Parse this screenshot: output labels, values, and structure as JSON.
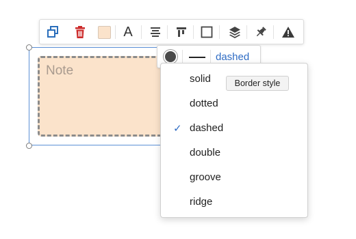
{
  "toolbar": {
    "icons": [
      "duplicate-icon",
      "delete-icon",
      "fill-color-swatch",
      "text-icon",
      "align-center-icon",
      "align-top-icon",
      "border-icon",
      "layers-icon",
      "pin-icon",
      "warning-icon"
    ],
    "fill_swatch_color": "#fbe3cb",
    "delete_color": "#cc2a2a",
    "accent_color": "#2a6ebb",
    "text_glyph": "A"
  },
  "note": {
    "text": "Note",
    "fill_color": "#fbe3cb",
    "border_color": "#8b8b8b",
    "border_style": "dashed"
  },
  "border_controls": {
    "color": "#4a4a4a",
    "style_value": "dashed"
  },
  "menu": {
    "items": [
      {
        "label": "solid",
        "checked": false
      },
      {
        "label": "dotted",
        "checked": false
      },
      {
        "label": "dashed",
        "checked": true
      },
      {
        "label": "double",
        "checked": false
      },
      {
        "label": "groove",
        "checked": false
      },
      {
        "label": "ridge",
        "checked": false
      }
    ],
    "check_glyph": "✓"
  },
  "tooltip": {
    "text": "Border style"
  }
}
